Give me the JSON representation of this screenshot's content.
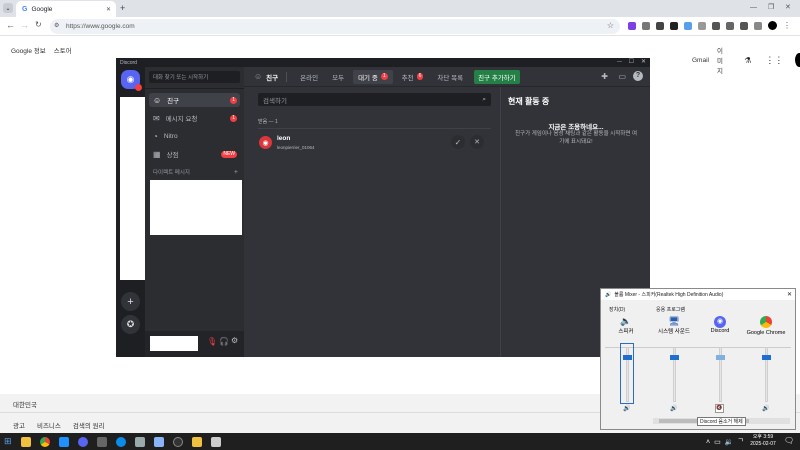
{
  "chrome": {
    "tab_title": "Google",
    "url": "https://www.google.com",
    "links_left": [
      "Google 정보",
      "스토어"
    ],
    "links_right": [
      "Gmail",
      "이미지"
    ],
    "footer_country": "대한민국",
    "footer_links": [
      "광고",
      "비즈니스",
      "검색의 원리"
    ]
  },
  "discord": {
    "window_title": "Discord",
    "search_placeholder": "대화 찾기 또는 시작하기",
    "dm_items": [
      {
        "label": "친구",
        "badge": "1"
      },
      {
        "label": "메시지 요청",
        "badge": "1"
      },
      {
        "label": "Nitro",
        "badge": ""
      },
      {
        "label": "상점",
        "badge": "NEW"
      }
    ],
    "dm_section": "다이렉트 메시지",
    "header_title": "친구",
    "tabs": [
      {
        "label": "온라인",
        "badge": ""
      },
      {
        "label": "모두",
        "badge": ""
      },
      {
        "label": "대기 중",
        "badge": "1"
      },
      {
        "label": "추천",
        "badge": "6"
      },
      {
        "label": "차단 목록",
        "badge": ""
      }
    ],
    "add_friend": "친구 추가하기",
    "friend_search_placeholder": "검색하기",
    "pending_label": "받음 — 1",
    "friend_name": "leon",
    "friend_tag": "leonpierrier_01064",
    "active_title": "현재 활동 중",
    "active_empty_title": "지금은 조용하네요...",
    "active_empty_body": "친구가 게임이나 음성 채팅과 같은 활동을 시작하면 여기에 표시돼요!"
  },
  "mixer": {
    "title": "볼륨 Mixer - 스피커(Realtek High Definition Audio)",
    "device_label": "장치(D)",
    "apps_label": "응용 프로그램",
    "device_name": "스피커",
    "apps": [
      "시스템 사운드",
      "Discord",
      "Google Chrome"
    ],
    "device_level": 0.85,
    "app_levels": [
      0.85,
      0.85,
      0.85
    ],
    "tooltip": "Discord 음소거 해제"
  },
  "taskbar": {
    "time": "오후 3:59",
    "date": "2025-02-07"
  }
}
